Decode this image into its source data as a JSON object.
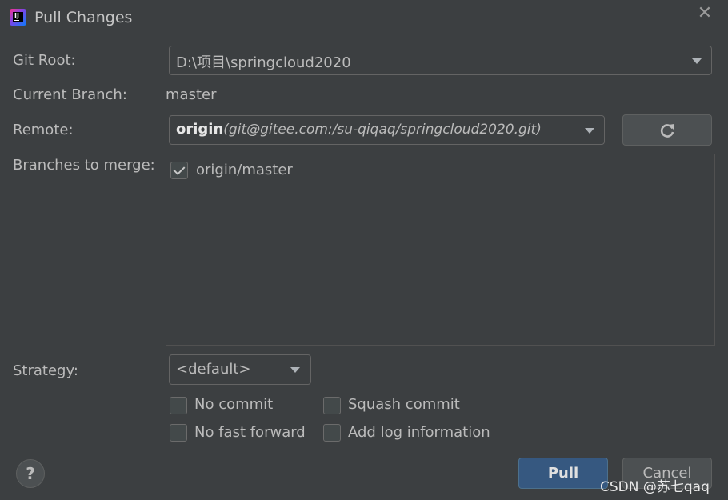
{
  "window": {
    "title": "Pull Changes",
    "close_symbol": "✕"
  },
  "git_root": {
    "label": "Git Root:",
    "value": "D:\\项目\\springcloud2020"
  },
  "current_branch": {
    "label": "Current Branch:",
    "value": "master"
  },
  "remote": {
    "label": "Remote:",
    "name": "origin",
    "url": "(git@gitee.com:/su-qiqaq/springcloud2020.git)"
  },
  "branches": {
    "label": "Branches to merge:",
    "items": [
      {
        "label": "origin/master",
        "checked": true
      }
    ]
  },
  "strategy": {
    "label": "Strategy:",
    "value": "<default>"
  },
  "options": {
    "no_commit": "No commit",
    "squash_commit": "Squash commit",
    "no_fast_forward": "No fast forward",
    "add_log_information": "Add log information"
  },
  "buttons": {
    "help": "?",
    "pull": "Pull",
    "cancel": "Cancel"
  },
  "watermark": "CSDN @苏七qaq",
  "icons": {
    "app": "intellij-idea-icon",
    "refresh": "refresh-icon",
    "close": "close-icon",
    "help": "help-icon"
  }
}
